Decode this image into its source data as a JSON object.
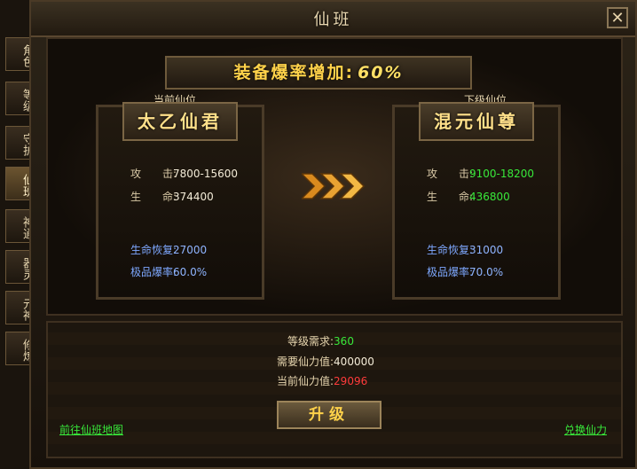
{
  "window": {
    "title": "仙班"
  },
  "tabs": [
    {
      "label": "角色",
      "active": false
    },
    {
      "label": "等级",
      "active": false
    },
    {
      "label": "守护",
      "active": false
    },
    {
      "label": "仙班",
      "active": true
    },
    {
      "label": "神通",
      "active": false
    },
    {
      "label": "器灵",
      "active": false
    },
    {
      "label": "元神",
      "active": false
    },
    {
      "label": "修炼",
      "active": false
    }
  ],
  "banner": {
    "text": "装备爆率增加:",
    "value": "60%"
  },
  "current": {
    "heading": "当前仙位",
    "name": "太乙仙君",
    "attack_label": "攻　　击:",
    "attack": "7800-15600",
    "life_label": "生　　命:",
    "life": "374400",
    "regen_label": "生命恢复:",
    "regen": "27000",
    "drop_label": "极品爆率:",
    "drop": "60.0%"
  },
  "next": {
    "heading": "下级仙位",
    "name": "混元仙尊",
    "attack_label": "攻　　击:",
    "attack": "9100-18200",
    "life_label": "生　　命:",
    "life": "436800",
    "regen_label": "生命恢复:",
    "regen": "31000",
    "drop_label": "极品爆率:",
    "drop": "70.0%"
  },
  "requirements": {
    "level_label": "等级需求:",
    "level": "360",
    "need_label": "需要仙力值:",
    "need": "400000",
    "have_label": "当前仙力值:",
    "have": "29096"
  },
  "buttons": {
    "upgrade": "升级"
  },
  "links": {
    "map": "前往仙班地图",
    "exchange": "兑换仙力"
  },
  "colors": {
    "accent_gold": "#ffd24a",
    "green": "#38e83a",
    "red": "#ff3b3b",
    "blue": "#7ea8ff"
  }
}
